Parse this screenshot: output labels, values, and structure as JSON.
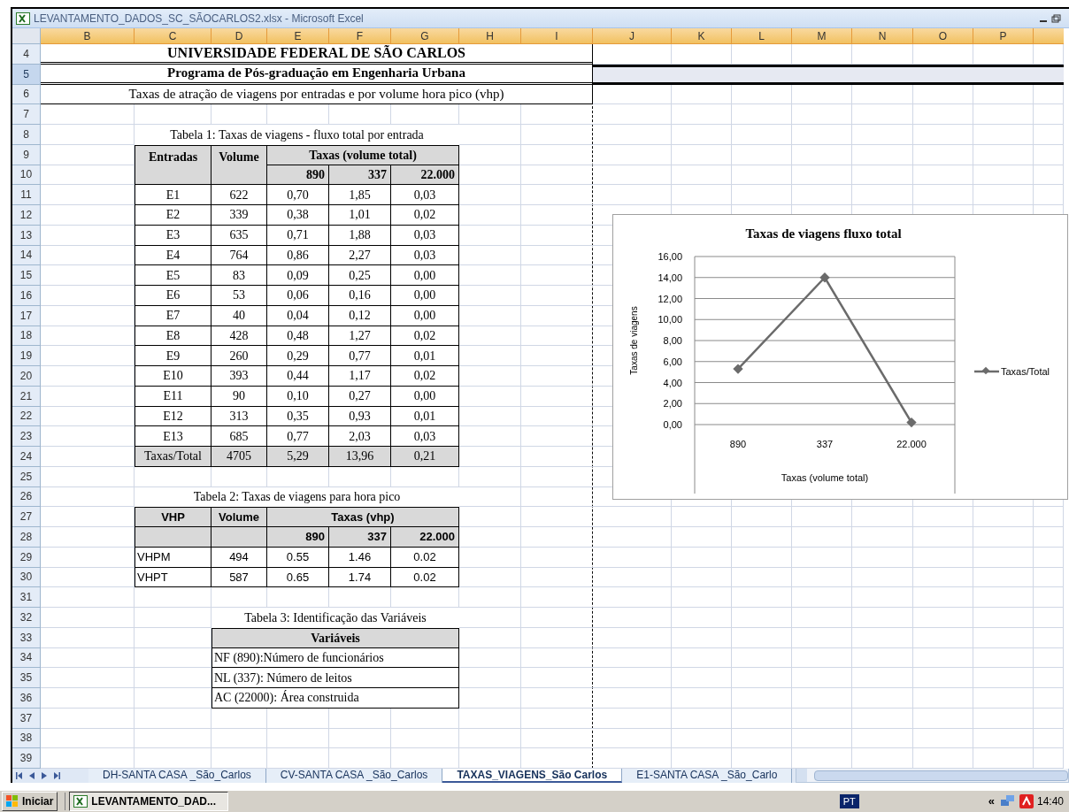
{
  "window": {
    "title": "LEVANTAMENTO_DADOS_SC_SÃOCARLOS2.xlsx - Microsoft Excel"
  },
  "column_headers": [
    "B",
    "C",
    "D",
    "E",
    "F",
    "G",
    "H",
    "I",
    "J",
    "K",
    "L",
    "M",
    "N",
    "O",
    "P"
  ],
  "row_headers": [
    {
      "label": "4",
      "selected": false
    },
    {
      "label": "5",
      "selected": true
    },
    {
      "label": "6",
      "selected": false
    },
    {
      "label": "7",
      "selected": false
    },
    {
      "label": "8",
      "selected": false
    },
    {
      "label": "9",
      "selected": false
    },
    {
      "label": "10",
      "selected": false
    },
    {
      "label": "11",
      "selected": false
    },
    {
      "label": "12",
      "selected": false
    },
    {
      "label": "13",
      "selected": false
    },
    {
      "label": "14",
      "selected": false
    },
    {
      "label": "15",
      "selected": false
    },
    {
      "label": "16",
      "selected": false
    },
    {
      "label": "17",
      "selected": false
    },
    {
      "label": "18",
      "selected": false
    },
    {
      "label": "19",
      "selected": false
    },
    {
      "label": "20",
      "selected": false
    },
    {
      "label": "21",
      "selected": false
    },
    {
      "label": "22",
      "selected": false
    },
    {
      "label": "23",
      "selected": false
    },
    {
      "label": "24",
      "selected": false
    },
    {
      "label": "25",
      "selected": false
    },
    {
      "label": "26",
      "selected": false
    },
    {
      "label": "27",
      "selected": false
    },
    {
      "label": "28",
      "selected": false
    },
    {
      "label": "29",
      "selected": false
    },
    {
      "label": "30",
      "selected": false
    },
    {
      "label": "31",
      "selected": false
    },
    {
      "label": "32",
      "selected": false
    },
    {
      "label": "33",
      "selected": false
    },
    {
      "label": "34",
      "selected": false
    },
    {
      "label": "35",
      "selected": false
    },
    {
      "label": "36",
      "selected": false
    },
    {
      "label": "37",
      "selected": false
    },
    {
      "label": "38",
      "selected": false
    },
    {
      "label": "39",
      "selected": false
    }
  ],
  "headings": [
    "UNIVERSIDADE FEDERAL DE SÃO CARLOS",
    "Programa de Pós-graduação em Engenharia Urbana",
    "Taxas de atração de viagens por entradas e por volume hora pico (vhp)"
  ],
  "table1": {
    "caption": "Tabela 1: Taxas de viagens - fluxo total por entrada",
    "header_rows": [
      [
        {
          "text": "Entradas",
          "rowspan": 2
        },
        {
          "text": "Volume",
          "rowspan": 2
        },
        {
          "text": "Taxas (volume total)",
          "colspan": 3
        }
      ],
      [
        {
          "text": "890"
        },
        {
          "text": "337"
        },
        {
          "text": "22.000"
        }
      ]
    ],
    "rows": [
      [
        "E1",
        "622",
        "0,70",
        "1,85",
        "0,03"
      ],
      [
        "E2",
        "339",
        "0,38",
        "1,01",
        "0,02"
      ],
      [
        "E3",
        "635",
        "0,71",
        "1,88",
        "0,03"
      ],
      [
        "E4",
        "764",
        "0,86",
        "2,27",
        "0,03"
      ],
      [
        "E5",
        "83",
        "0,09",
        "0,25",
        "0,00"
      ],
      [
        "E6",
        "53",
        "0,06",
        "0,16",
        "0,00"
      ],
      [
        "E7",
        "40",
        "0,04",
        "0,12",
        "0,00"
      ],
      [
        "E8",
        "428",
        "0,48",
        "1,27",
        "0,02"
      ],
      [
        "E9",
        "260",
        "0,29",
        "0,77",
        "0,01"
      ],
      [
        "E10",
        "393",
        "0,44",
        "1,17",
        "0,02"
      ],
      [
        "E11",
        "90",
        "0,10",
        "0,27",
        "0,00"
      ],
      [
        "E12",
        "313",
        "0,35",
        "0,93",
        "0,01"
      ],
      [
        "E13",
        "685",
        "0,77",
        "2,03",
        "0,03"
      ]
    ],
    "total": [
      "Taxas/Total",
      "4705",
      "5,29",
      "13,96",
      "0,21"
    ]
  },
  "table2": {
    "caption": "Tabela 2: Taxas de viagens para hora pico",
    "header_rows": [
      [
        {
          "text": "VHP"
        },
        {
          "text": "Volume"
        },
        {
          "text": "Taxas (vhp)",
          "colspan": 3
        }
      ],
      [
        {
          "kind": "blank"
        },
        {
          "kind": "blank"
        },
        {
          "text": "890"
        },
        {
          "text": "337"
        },
        {
          "text": "22.000"
        }
      ]
    ],
    "rows": [
      [
        "VHPM",
        "494",
        "0.55",
        "1.46",
        "0.02"
      ],
      [
        "VHPT",
        "587",
        "0.65",
        "1.74",
        "0.02"
      ]
    ]
  },
  "table3": {
    "caption": "Tabela 3: Identificação das Variáveis",
    "header": "Variáveis",
    "rows": [
      "NF (890):Número de funcionários",
      "NL (337): Número de leitos",
      "AC (22000): Área construida"
    ]
  },
  "chart": {
    "chart_data": {
      "type": "line",
      "title": "Taxas de viagens fluxo total",
      "xlabel": "Taxas (volume total)",
      "ylabel": "Taxas de viagens",
      "categories": [
        "890",
        "337",
        "22.000"
      ],
      "series": [
        {
          "name": "Taxas/Total",
          "color": "#6b6b6b",
          "marker": "diamond",
          "values": [
            5.3,
            14.0,
            0.2
          ]
        }
      ],
      "grid": true,
      "ylim": [
        0,
        16
      ],
      "yticks": [
        {
          "value": 0,
          "label": "0,00"
        },
        {
          "value": 2,
          "label": "2,00"
        },
        {
          "value": 4,
          "label": "4,00"
        },
        {
          "value": 6,
          "label": "6,00"
        },
        {
          "value": 8,
          "label": "8,00"
        },
        {
          "value": 10,
          "label": "10,00"
        },
        {
          "value": 12,
          "label": "12,00"
        },
        {
          "value": 14,
          "label": "14,00"
        },
        {
          "value": 16,
          "label": "16,00"
        }
      ]
    }
  },
  "sheet_tabs": [
    {
      "label": "DH-SANTA CASA _São_Carlos",
      "selected": false
    },
    {
      "label": "CV-SANTA CASA _São_Carlos",
      "selected": false
    },
    {
      "label": "TAXAS_VIAGENS_São Carlos",
      "selected": true
    },
    {
      "label": "E1-SANTA CASA _São_Carlo",
      "selected": false
    }
  ],
  "taskbar": {
    "start": "Iniciar",
    "task": "LEVANTAMENTO_DAD...",
    "language": "PT",
    "tray_toggle": "«",
    "time": "14:40"
  }
}
